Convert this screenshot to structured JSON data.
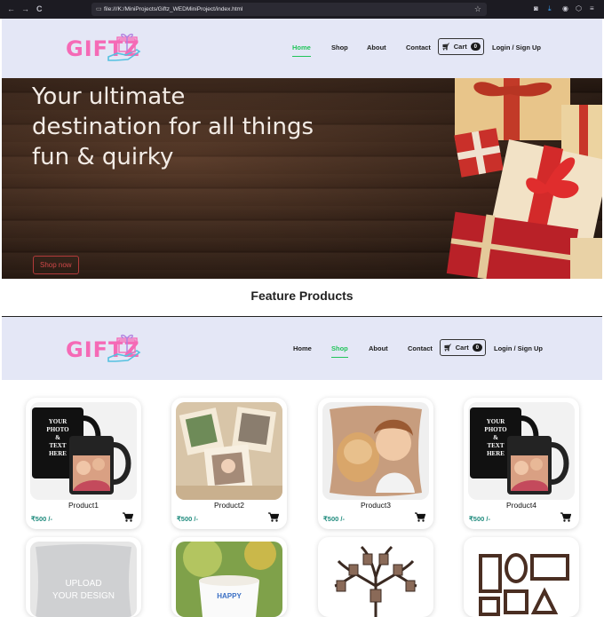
{
  "browser": {
    "back_glyph": "←",
    "forward_glyph": "→",
    "reload_glyph": "C",
    "url": "file:///K:/MiniProjects/Giftz_WEDMiniProject/index.html"
  },
  "brand": {
    "logo_text": "GIFTZ",
    "accent": "#f56ab6",
    "link_active": "#21c45a"
  },
  "nav": {
    "home": "Home",
    "shop": "Shop",
    "about": "About",
    "contact": "Contact",
    "cart": "Cart",
    "cart_count": "0",
    "login": "Login / Sign Up"
  },
  "hero": {
    "title": "Your ultimate destination for all things fun & quirky",
    "cta": "Shop now"
  },
  "feature_heading": "Feature Products",
  "products": [
    {
      "name": "Product1",
      "price": "₹500 /-",
      "image": "photo-mug-black"
    },
    {
      "name": "Product2",
      "price": "₹500 /-",
      "image": "photo-box"
    },
    {
      "name": "Product3",
      "price": "₹500 /-",
      "image": "photo-cushion"
    },
    {
      "name": "Product4",
      "price": "₹500 /-",
      "image": "photo-mug-black"
    },
    {
      "name": "",
      "price": "",
      "image": "upload-cushion"
    },
    {
      "name": "",
      "price": "",
      "image": "happy-mug"
    },
    {
      "name": "",
      "price": "",
      "image": "family-tree-frame"
    },
    {
      "name": "",
      "price": "",
      "image": "wall-frames"
    }
  ],
  "image_text": {
    "mug_lines": [
      "YOUR",
      "PHOTO",
      "&",
      "TEXT",
      "HERE"
    ],
    "upload_lines": [
      "UPLOAD",
      "YOUR DESIGN"
    ],
    "happy": "HAPPY"
  }
}
